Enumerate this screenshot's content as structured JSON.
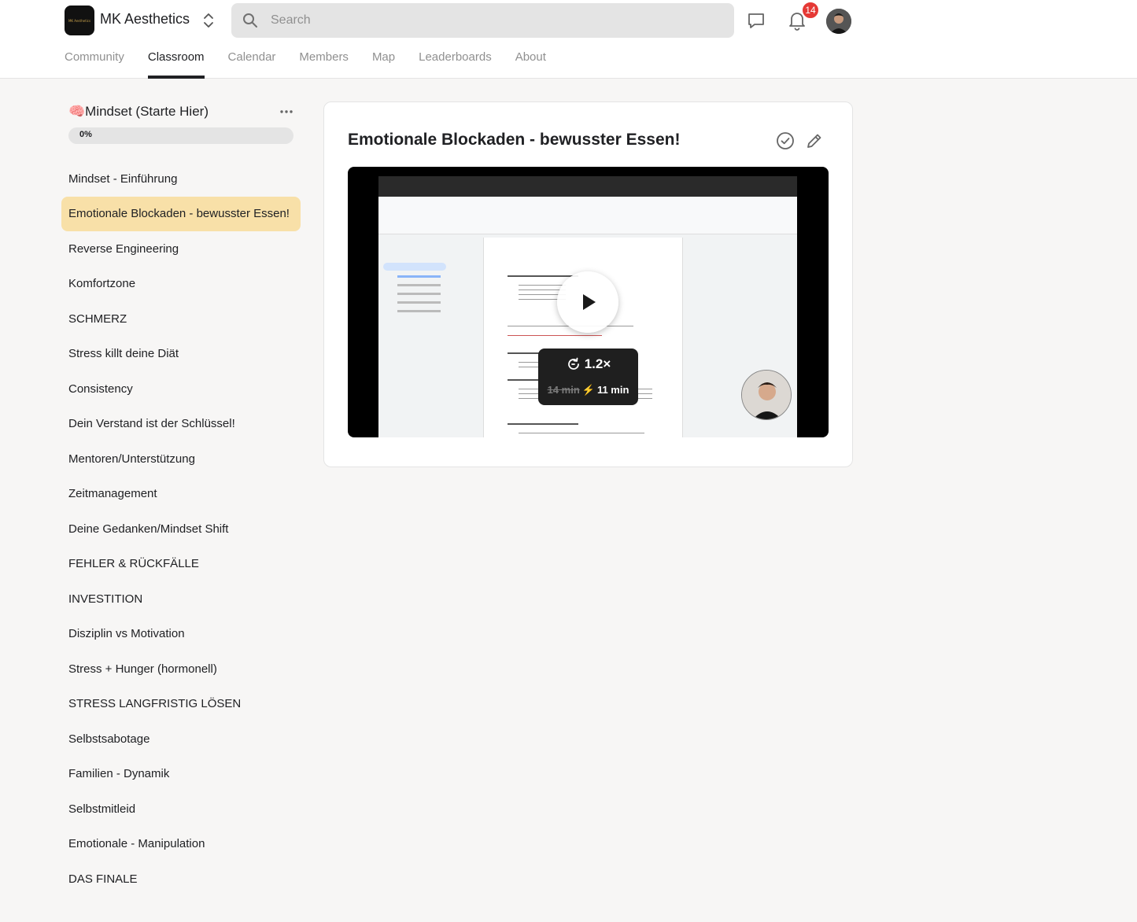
{
  "header": {
    "logo_text": "MK Aesthetics",
    "app_name": "MK Aesthetics",
    "search_placeholder": "Search",
    "notification_count": "14"
  },
  "nav": {
    "tabs": [
      {
        "label": "Community",
        "active": false
      },
      {
        "label": "Classroom",
        "active": true
      },
      {
        "label": "Calendar",
        "active": false
      },
      {
        "label": "Members",
        "active": false
      },
      {
        "label": "Map",
        "active": false
      },
      {
        "label": "Leaderboards",
        "active": false
      },
      {
        "label": "About",
        "active": false
      }
    ]
  },
  "course": {
    "title": "🧠Mindset (Starte Hier)",
    "progress_label": "0%",
    "progress_fraction": 0,
    "lessons": [
      "Mindset - Einführung",
      "Emotionale Blockaden - bewusster Essen!",
      "Reverse Engineering",
      "Komfortzone",
      "SCHMERZ",
      "Stress killt deine Diät",
      "Consistency",
      "Dein Verstand ist der Schlüssel!",
      "Mentoren/Unterstützung",
      "Zeitmanagement",
      "Deine Gedanken/Mindset Shift",
      "FEHLER & RÜCKFÄLLE",
      "INVESTITION",
      "Disziplin vs Motivation",
      "Stress + Hunger (hormonell)",
      "STRESS LANGFRISTIG LÖSEN",
      "Selbstsabotage",
      "Familien - Dynamik",
      "Selbstmitleid",
      "Emotionale - Manipulation",
      "DAS FINALE"
    ],
    "active_lesson_index": 1
  },
  "lesson": {
    "title": "Emotionale Blockaden - bewusster Essen!",
    "video": {
      "speed": "1.2×",
      "original_duration": "14 min",
      "fast_duration": "11 min"
    }
  },
  "colors": {
    "active_lesson_bg": "#f8e0a8",
    "badge_red": "#e53935",
    "text_primary": "#202124",
    "text_muted": "#909090"
  },
  "icons": [
    "search-icon",
    "switcher-icon",
    "chat-icon",
    "bell-icon",
    "more-icon",
    "check-circle-icon",
    "pencil-icon",
    "play-icon",
    "speed-icon",
    "bolt-icon"
  ]
}
